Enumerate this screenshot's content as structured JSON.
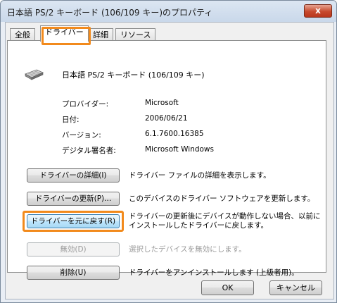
{
  "window": {
    "title": "日本語 PS/2 キーボード (106/109 キー)のプロパティ",
    "close_glyph": "x"
  },
  "tabs": [
    {
      "label": "全般",
      "active": false
    },
    {
      "label": "ドライバー",
      "active": true
    },
    {
      "label": "詳細",
      "active": false
    },
    {
      "label": "リソース",
      "active": false
    }
  ],
  "device": {
    "icon": "keyboard-icon",
    "name": "日本語 PS/2 キーボード (106/109 キー)"
  },
  "info": [
    {
      "label": "プロバイダー:",
      "value": "Microsoft"
    },
    {
      "label": "日付:",
      "value": "2006/06/21"
    },
    {
      "label": "バージョン:",
      "value": "6.1.7600.16385"
    },
    {
      "label": "デジタル署名者:",
      "value": "Microsoft Windows"
    }
  ],
  "actions": [
    {
      "button": "ドライバーの詳細(I)",
      "description": "ドライバー ファイルの詳細を表示します。",
      "enabled": true
    },
    {
      "button": "ドライバーの更新(P)...",
      "description": "このデバイスのドライバー ソフトウェアを更新します。",
      "enabled": true
    },
    {
      "button": "ドライバーを元に戻す(R)",
      "description_line1": "ドライバーの更新後にデバイスが動作しない場合、以前に",
      "description_line2": "インストールしたドライバーに戻します。",
      "enabled": true
    },
    {
      "button": "無効(D)",
      "description": "選択したデバイスを無効にします。",
      "enabled": false
    },
    {
      "button": "削除(U)",
      "description": "ドライバーをアンインストールします (上級者用)。",
      "enabled": true
    }
  ],
  "footer": {
    "ok_label": "OK",
    "cancel_label": "キャンセル"
  },
  "colors": {
    "highlight": "#f28a1c",
    "close_button": "#c74a2d"
  }
}
